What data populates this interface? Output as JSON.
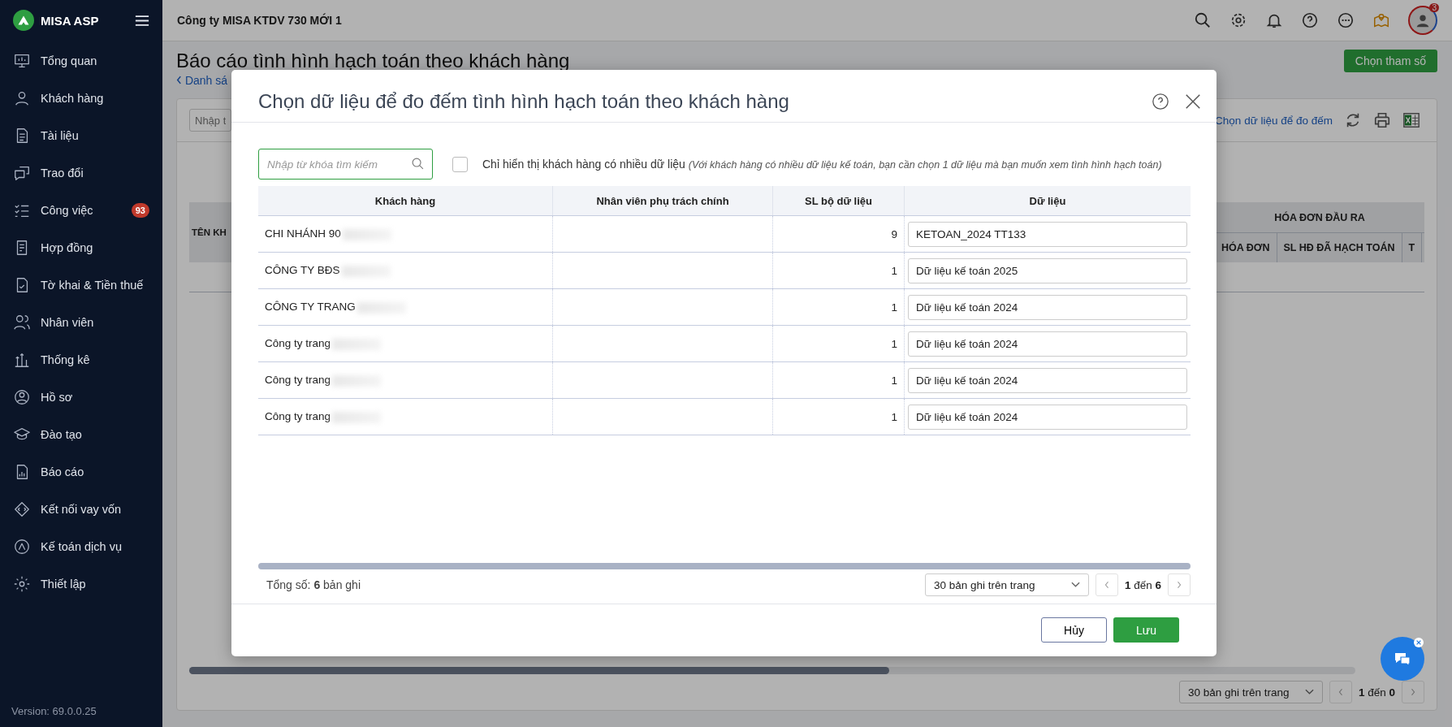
{
  "sidebar": {
    "logo": "MISA ASP",
    "items": [
      {
        "label": "Tổng quan",
        "selected": false
      },
      {
        "label": "Khách hàng",
        "selected": false
      },
      {
        "label": "Tài liệu",
        "selected": false
      },
      {
        "label": "Trao đổi",
        "selected": false
      },
      {
        "label": "Công việc",
        "selected": false,
        "badge": "93"
      },
      {
        "label": "Hợp đồng",
        "selected": false
      },
      {
        "label": "Tờ khai & Tiền thuế",
        "selected": false
      },
      {
        "label": "Nhân viên",
        "selected": false
      },
      {
        "label": "Thống kê",
        "selected": false
      },
      {
        "label": "Hồ sơ",
        "selected": false
      },
      {
        "label": "Đào tạo",
        "selected": false
      },
      {
        "label": "Báo cáo",
        "selected": false
      },
      {
        "label": "Kết nối vay vốn",
        "selected": false
      },
      {
        "label": "Kế toán dịch vụ",
        "selected": false
      },
      {
        "label": "Thiết lập",
        "selected": false
      }
    ],
    "version": "Version: 69.0.0.25"
  },
  "header": {
    "company": "Công ty MISA KTDV 730 MỚI 1",
    "notification_count": "3"
  },
  "page": {
    "title": "Báo cáo tình hình hạch toán theo khách hàng",
    "back_link": "Danh sá",
    "params_button": "Chọn tham số",
    "search": {
      "placeholder": "Nhập t"
    },
    "choose_data_link": "Chọn dữ liệu để đo đếm",
    "table": {
      "left_header": "TÊN KH",
      "group_header": "HÓA ĐƠN ĐẦU RA",
      "columns": [
        "HÓA ĐƠN",
        "SL HĐ ĐÃ HẠCH TOÁN",
        "T"
      ]
    },
    "pager": {
      "page_size": "30 bản ghi trên trang",
      "range": "**1** đến **0**"
    }
  },
  "dialog": {
    "title": "Chọn dữ liệu để đo đếm tình hình hạch toán theo khách hàng",
    "search": {
      "placeholder": "Nhập từ khóa tìm kiếm"
    },
    "filter": {
      "checked": false,
      "label": "Chỉ hiển thị khách hàng có nhiều dữ liệu",
      "note": "(Với khách hàng có nhiều dữ liệu kế toán, bạn cần chọn 1 dữ liệu mà bạn muốn xem tình hình hạch toán)"
    },
    "table": {
      "columns": [
        "Khách hàng",
        "Nhân viên phụ trách chính",
        "SL bộ dữ liệu",
        "Dữ liệu"
      ],
      "rows": [
        {
          "customer": "CHI NHÁNH 90",
          "redacted": true,
          "staff": "",
          "count": "9",
          "data": "KETOAN_2024 TT133"
        },
        {
          "customer": "CÔNG TY BĐS",
          "redacted": true,
          "staff": "",
          "count": "1",
          "data": "Dữ liệu kế toán 2025"
        },
        {
          "customer": "CÔNG TY TRANG",
          "redacted": true,
          "staff": "",
          "count": "1",
          "data": "Dữ liệu kế toán 2024"
        },
        {
          "customer": "Công ty trang",
          "redacted": true,
          "staff": "",
          "count": "1",
          "data": "Dữ liệu kế toán 2024"
        },
        {
          "customer": "Công ty trang",
          "redacted": true,
          "staff": "",
          "count": "1",
          "data": "Dữ liệu kế toán 2024"
        },
        {
          "customer": "Công ty trang",
          "redacted": true,
          "staff": "",
          "count": "1",
          "data": "Dữ liệu kế toán 2024"
        }
      ]
    },
    "total": "Tổng số: **6** bản ghi",
    "page_size": "30 bản ghi trên trang",
    "range": "**1** đến **6**",
    "buttons": {
      "cancel": "Hủy",
      "save": "Lưu"
    }
  }
}
